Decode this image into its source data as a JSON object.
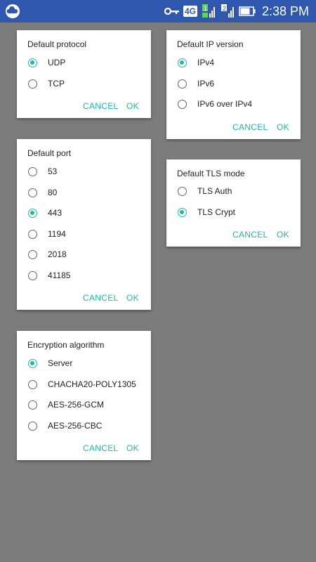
{
  "status_bar": {
    "network": "4G",
    "sim1": "1",
    "sim2": "2",
    "time": "2:38 PM"
  },
  "accent_color": "#1db8a8",
  "dialogs": {
    "protocol": {
      "title": "Default protocol",
      "options": [
        "UDP",
        "TCP"
      ],
      "selected": "UDP",
      "cancel": "CANCEL",
      "ok": "OK"
    },
    "ip_version": {
      "title": "Default IP version",
      "options": [
        "IPv4",
        "IPv6",
        "IPv6 over IPv4"
      ],
      "selected": "IPv4",
      "cancel": "CANCEL",
      "ok": "OK"
    },
    "port": {
      "title": "Default port",
      "options": [
        "53",
        "80",
        "443",
        "1194",
        "2018",
        "41185"
      ],
      "selected": "443",
      "cancel": "CANCEL",
      "ok": "OK"
    },
    "tls_mode": {
      "title": "Default TLS mode",
      "options": [
        "TLS Auth",
        "TLS Crypt"
      ],
      "selected": "TLS Crypt",
      "cancel": "CANCEL",
      "ok": "OK"
    },
    "encryption": {
      "title": "Encryption algorithm",
      "options": [
        "Server",
        "CHACHA20-POLY1305",
        "AES-256-GCM",
        "AES-256-CBC"
      ],
      "selected": "Server",
      "cancel": "CANCEL",
      "ok": "OK"
    }
  }
}
